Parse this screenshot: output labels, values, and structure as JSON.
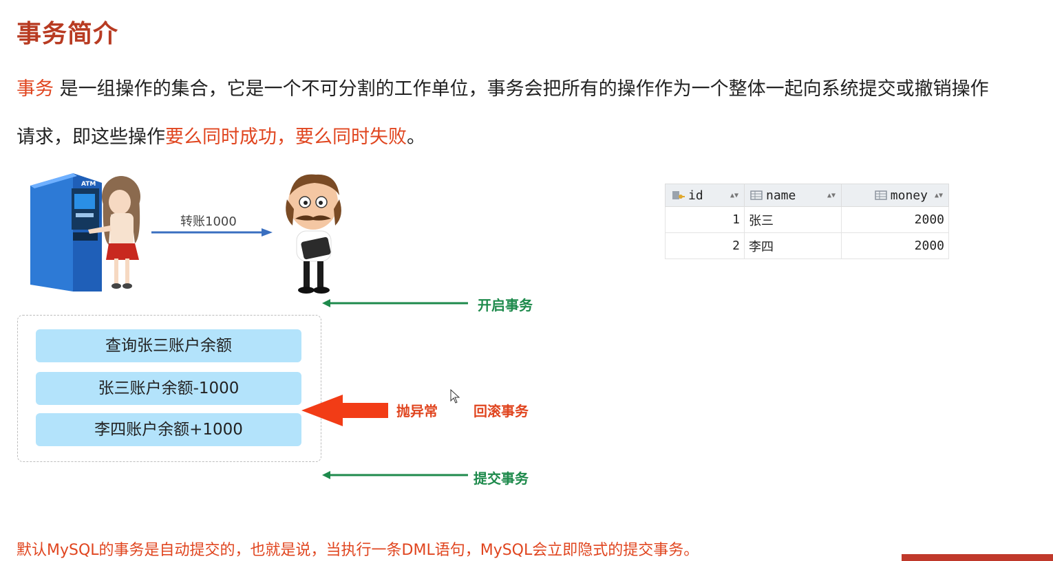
{
  "page": {
    "title": "事务简介",
    "intro": {
      "keyword": "事务",
      "line1_rest": " 是一组操作的集合，它是一个不可分割的工作单位，事务会把所有的操作作为一个整体一起向系统提交或撤销操作",
      "line2_start": "请求，即这些操作",
      "line2_highlight": "要么同时成功，要么同时失败",
      "line2_end": "。"
    },
    "footer_note": "默认MySQL的事务是自动提交的，也就是说，当执行一条DML语句，MySQL会立即隐式的提交事务。"
  },
  "diagram": {
    "atm_text": "ATM",
    "transfer_label": "转账1000",
    "begin_label": "开启事务",
    "exception_label": "抛异常",
    "rollback_label": "回滚事务",
    "commit_label": "提交事务",
    "steps": [
      "查询张三账户余额",
      "张三账户余额-1000",
      "李四账户余额+1000"
    ],
    "colors": {
      "step_fill": "#b3e3fb",
      "green_arrow": "#1e8a4c",
      "red_arrow": "#f23c16",
      "highlight": "#e0451f",
      "title": "#b83b22"
    }
  },
  "table": {
    "columns": [
      "id",
      "name",
      "money"
    ],
    "column_icons": [
      "primary-key-icon",
      "column-icon",
      "column-icon"
    ],
    "rows": [
      {
        "id": "1",
        "name": "张三",
        "money": "2000"
      },
      {
        "id": "2",
        "name": "李四",
        "money": "2000"
      }
    ]
  }
}
